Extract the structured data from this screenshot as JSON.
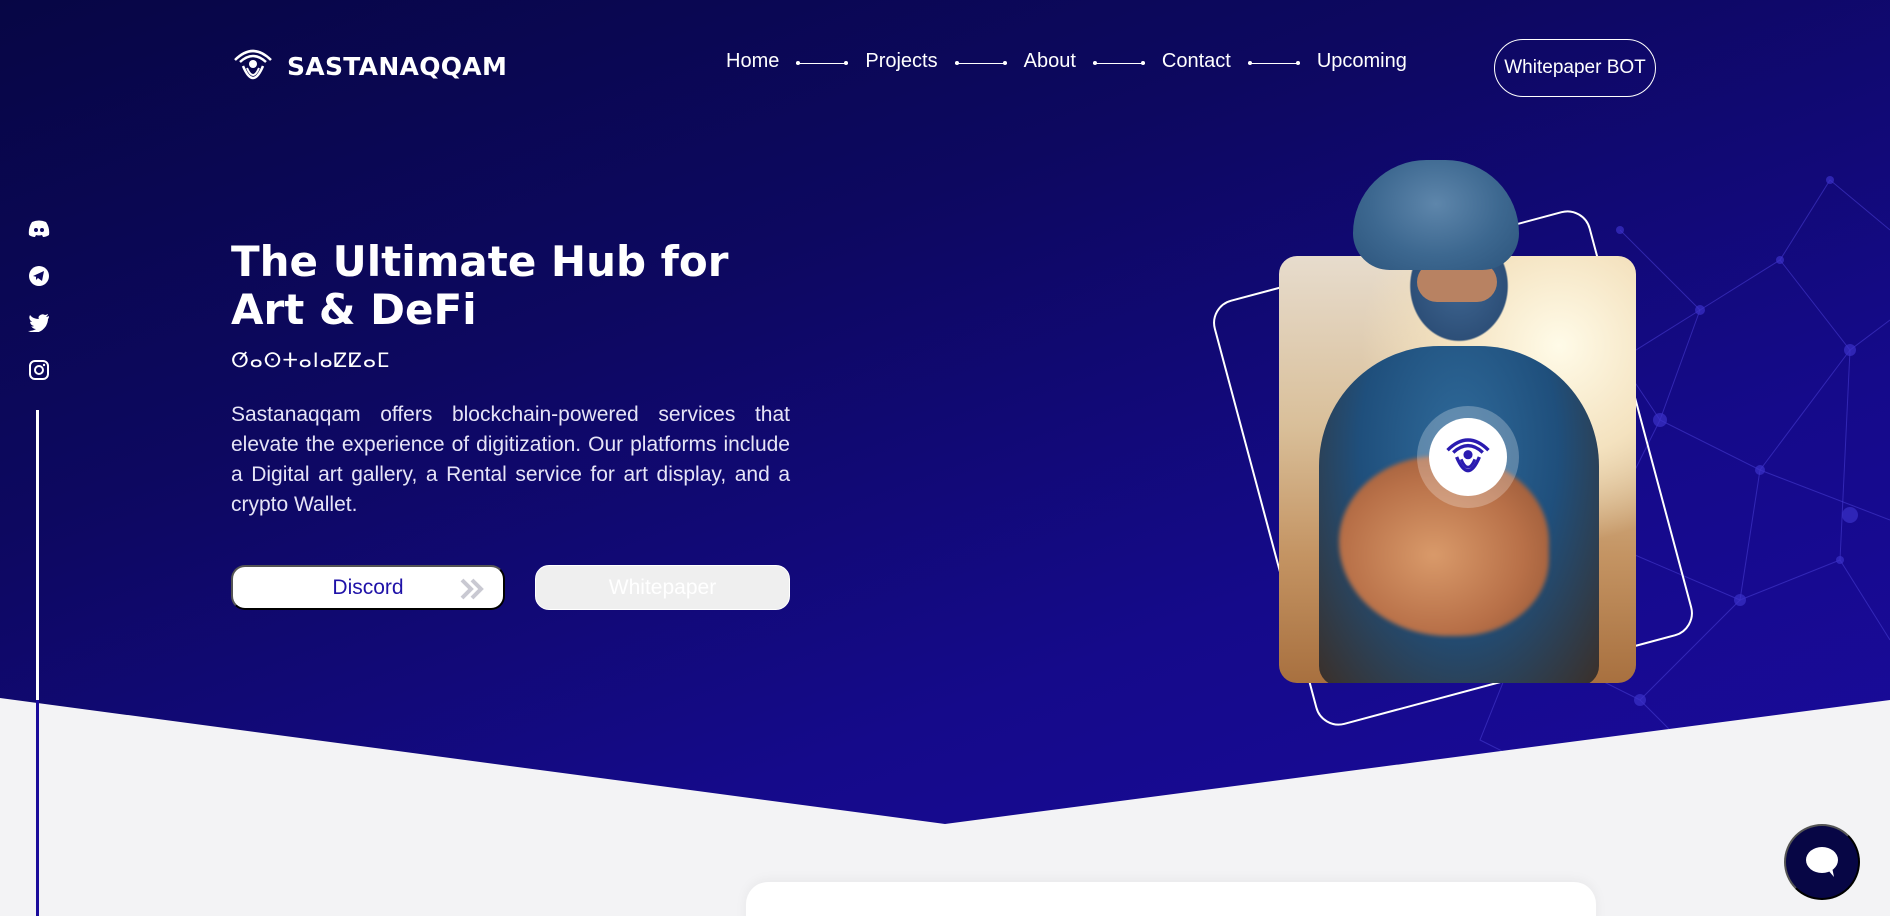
{
  "brand": {
    "name": "SASTANAQQAM",
    "logo_icon": "eye-logo-icon"
  },
  "nav": {
    "items": [
      {
        "label": "Home"
      },
      {
        "label": "Projects"
      },
      {
        "label": "About"
      },
      {
        "label": "Contact"
      },
      {
        "label": "Upcoming"
      }
    ],
    "cta_label": "Whitepaper BOT"
  },
  "social": [
    "discord-icon",
    "telegram-icon",
    "twitter-icon",
    "instagram-icon"
  ],
  "hero": {
    "title": "The Ultimate Hub for Art & DeFi",
    "subtitle": "ⵚⴰⵙⵜⴰⵏⴰⵇⵇⴰⵎ",
    "description": "Sastanaqqam offers blockchain-powered services that elevate the experience of digitization. Our platforms include a Digital art gallery, a Rental service for art display, and a crypto Wallet.",
    "primary_button": "Discord",
    "secondary_button": "Whitepaper"
  },
  "colors": {
    "hero_dark": "#070645",
    "hero_light": "#1a0b9b",
    "page_bg": "#f3f3f5",
    "accent_text": "#1f12a8"
  },
  "chat_widget": {
    "icon": "chat-bubble-icon"
  }
}
